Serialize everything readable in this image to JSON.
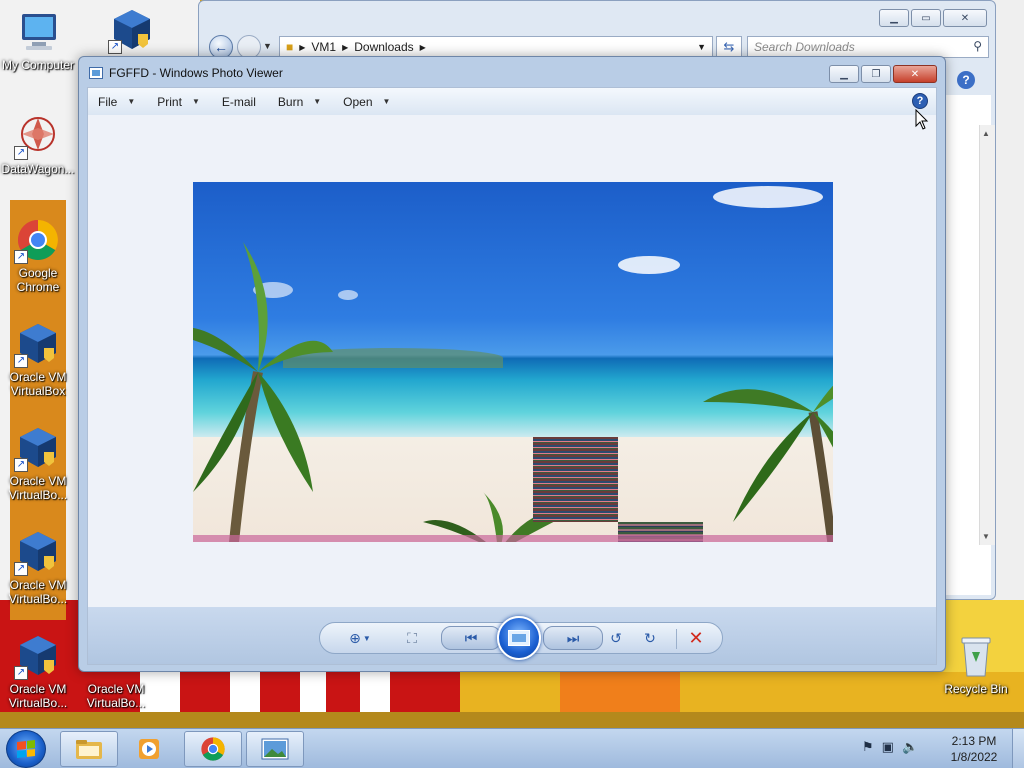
{
  "desktop": {
    "icons": [
      {
        "label": "My Computer",
        "icon": "my-computer-icon"
      },
      {
        "label": "DataWagon...",
        "icon": "datawagon-icon"
      },
      {
        "label": "Google Chrome",
        "icon": "chrome-icon"
      },
      {
        "label": "Oracle VM VirtualBox",
        "icon": "virtualbox-icon"
      },
      {
        "label": "Oracle VM VirtualBo...",
        "icon": "virtualbox-icon"
      },
      {
        "label": "Oracle VM VirtualBo...",
        "icon": "virtualbox-icon"
      },
      {
        "label": "Oracle VM VirtualBo...",
        "icon": "virtualbox-icon"
      },
      {
        "label": "Oracle VM VirtualBo...",
        "icon": "virtualbox-icon"
      },
      {
        "label": "Recycle Bin",
        "icon": "recycle-bin-icon"
      }
    ]
  },
  "explorer": {
    "breadcrumb": [
      "VM1",
      "Downloads"
    ],
    "search_placeholder": "Search Downloads"
  },
  "viewer": {
    "title": "FGFFD - Windows Photo Viewer",
    "menu": [
      {
        "label": "File",
        "has_dropdown": true
      },
      {
        "label": "Print",
        "has_dropdown": true
      },
      {
        "label": "E-mail",
        "has_dropdown": false
      },
      {
        "label": "Burn",
        "has_dropdown": true
      },
      {
        "label": "Open",
        "has_dropdown": true
      }
    ],
    "help_glyph": "?",
    "controls": [
      "zoom",
      "actual-size",
      "previous",
      "slideshow",
      "next",
      "rotate-counterclockwise",
      "rotate-clockwise",
      "delete"
    ]
  },
  "taskbar": {
    "apps": [
      "windows-explorer",
      "media-player",
      "google-chrome",
      "windows-photo-viewer"
    ],
    "clock": {
      "time": "2:13 PM",
      "date": "1/8/2022"
    }
  },
  "colors": {
    "title_bar": "#b9cde6",
    "close_red": "#c6402b",
    "taskbar": "#9fbadd",
    "accent_blue": "#1a5fd1"
  }
}
